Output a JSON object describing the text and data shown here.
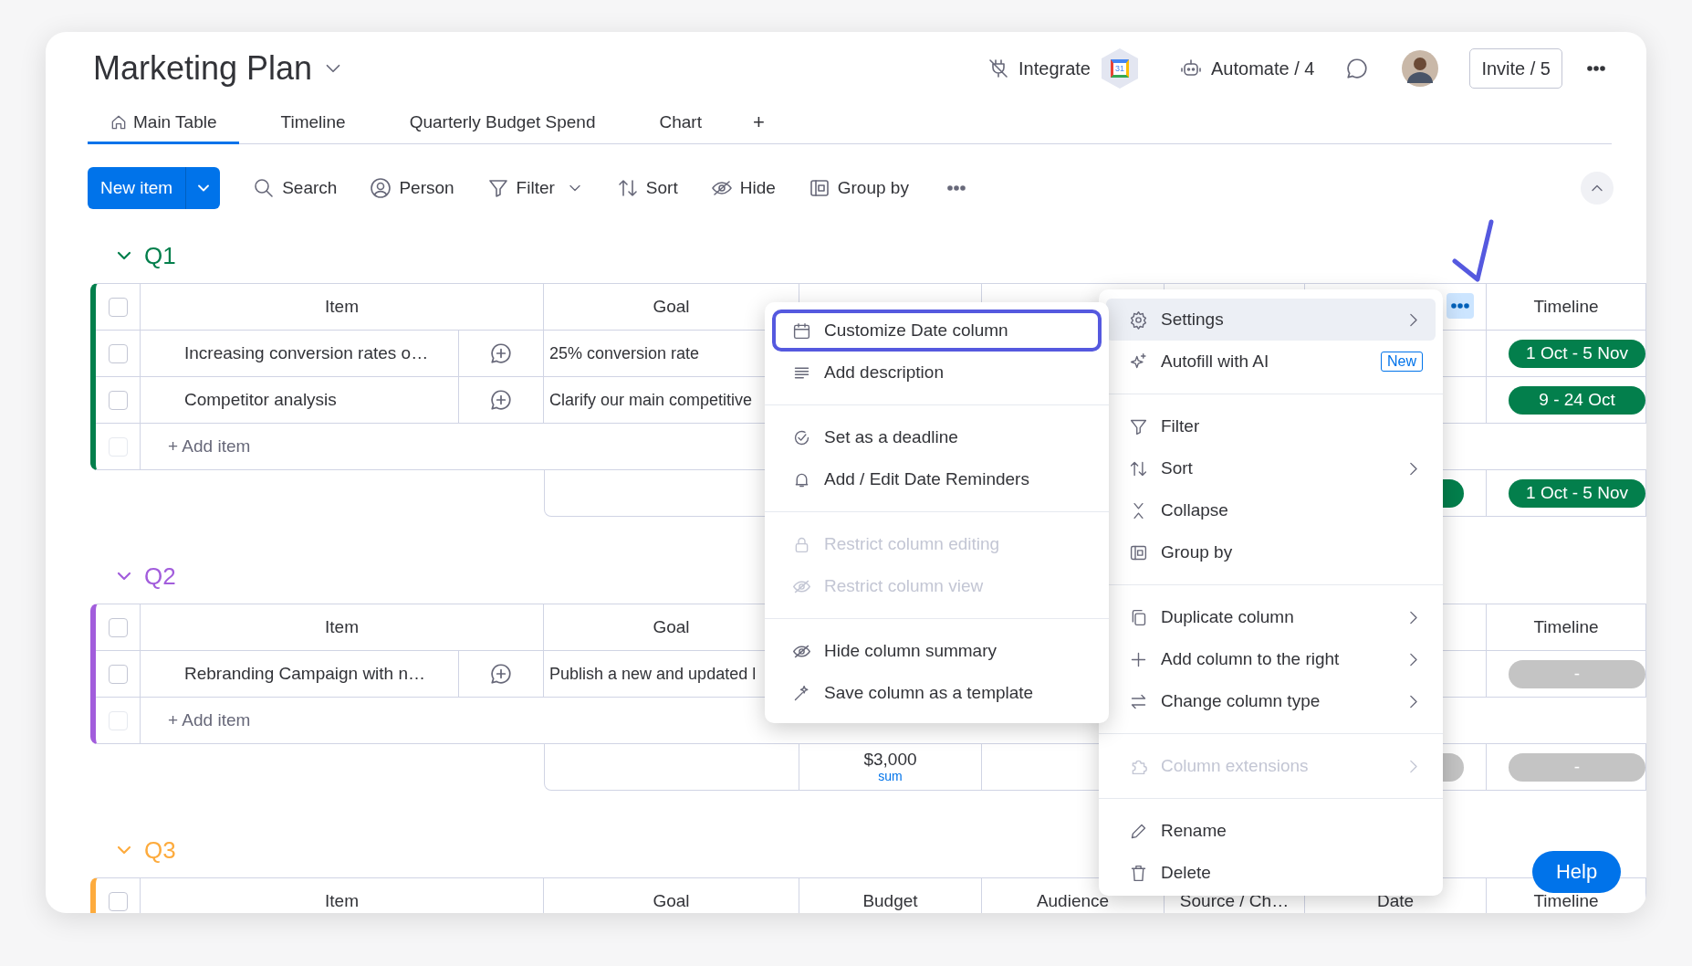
{
  "board": {
    "title": "Marketing Plan"
  },
  "header": {
    "integrate": "Integrate",
    "integration_badge": "31",
    "automate": "Automate / 4",
    "invite": "Invite / 5"
  },
  "tabs": [
    {
      "label": "Main Table",
      "selected": true,
      "kind": "home"
    },
    {
      "label": "Timeline",
      "selected": false,
      "kind": "plain"
    },
    {
      "label": "Quarterly Budget Spend",
      "selected": false,
      "kind": "plain"
    },
    {
      "label": "Chart",
      "selected": false,
      "kind": "plain"
    }
  ],
  "add_view": "+",
  "toolbar": {
    "new_item": "New item",
    "tools": [
      {
        "label": "Search",
        "kind": "search",
        "dropdown": false
      },
      {
        "label": "Person",
        "kind": "person",
        "dropdown": false
      },
      {
        "label": "Filter",
        "kind": "filter",
        "dropdown": true
      },
      {
        "label": "Sort",
        "kind": "sort",
        "dropdown": false
      },
      {
        "label": "Hide",
        "kind": "eye-off",
        "dropdown": false
      },
      {
        "label": "Group by",
        "kind": "group",
        "dropdown": false
      }
    ]
  },
  "groups": [
    {
      "name": "Q1",
      "color": "#037f4c",
      "checked": false,
      "date_menu_open": true,
      "columns": [
        {
          "kind": "item",
          "label": "Item"
        },
        {
          "kind": "goal",
          "label": "Goal"
        },
        {
          "kind": "timeline",
          "label": "Timeline"
        }
      ],
      "rows": [
        {
          "checked": false,
          "item": "Increasing conversion rates o…",
          "goal": "25% conversion rate",
          "timeline": {
            "label": "1 Oct - 5 Nov",
            "color": "#037f4c"
          }
        },
        {
          "checked": false,
          "item": "Competitor analysis",
          "goal": "Clarify our main competitive",
          "timeline": {
            "label": "9 - 24 Oct",
            "color": "#037f4c"
          }
        }
      ],
      "add_item": {
        "label": "+ Add item",
        "checked": false
      },
      "summary": {
        "date": {
          "color": "#037f4c"
        },
        "timeline": {
          "label": "1 Oct - 5 Nov",
          "color": "#037f4c"
        }
      }
    },
    {
      "name": "Q2",
      "color": "#a25ddc",
      "checked": false,
      "date_menu_open": false,
      "columns": [
        {
          "kind": "item",
          "label": "Item"
        },
        {
          "kind": "goal",
          "label": "Goal"
        },
        {
          "kind": "timeline",
          "label": "Timeline"
        }
      ],
      "rows": [
        {
          "checked": false,
          "item": "Rebranding Campaign with n…",
          "goal": "Publish a new and updated l",
          "timeline": {
            "label": "-",
            "color": "#c4c4c4"
          }
        }
      ],
      "add_item": {
        "label": "+ Add item",
        "checked": false
      },
      "summary": {
        "budget": "$3,000",
        "budget_note": "sum",
        "date": {
          "color": "#c4c4c4"
        },
        "timeline": {
          "label": "-",
          "color": "#c4c4c4"
        }
      }
    },
    {
      "name": "Q3",
      "color": "#fdab3d",
      "checked": false,
      "date_menu_open": false,
      "columns": [
        {
          "kind": "item",
          "label": "Item"
        },
        {
          "kind": "goal",
          "label": "Goal"
        },
        {
          "kind": "budget",
          "label": "Budget"
        },
        {
          "kind": "audience",
          "label": "Audience"
        },
        {
          "kind": "source",
          "label": "Source / Ch…"
        },
        {
          "kind": "date",
          "label": "Date"
        },
        {
          "kind": "timeline",
          "label": "Timeline"
        }
      ]
    }
  ],
  "settings_submenu": {
    "sections": [
      [
        {
          "label": "Customize Date column",
          "kind": "calendar",
          "selected": true,
          "disabled": false
        },
        {
          "label": "Add description",
          "kind": "lines",
          "selected": false,
          "disabled": false
        }
      ],
      [
        {
          "label": "Set as a deadline",
          "kind": "deadline",
          "selected": false,
          "disabled": false
        },
        {
          "label": "Add / Edit Date Reminders",
          "kind": "bell",
          "selected": false,
          "disabled": false
        }
      ],
      [
        {
          "label": "Restrict column editing",
          "kind": "lock",
          "selected": false,
          "disabled": true
        },
        {
          "label": "Restrict column view",
          "kind": "eye-off",
          "selected": false,
          "disabled": true
        }
      ],
      [
        {
          "label": "Hide column summary",
          "kind": "eye-off",
          "selected": false,
          "disabled": false
        },
        {
          "label": "Save column as a template",
          "kind": "wand",
          "selected": false,
          "disabled": false
        }
      ]
    ]
  },
  "column_menu": {
    "sections": [
      [
        {
          "label": "Settings",
          "kind": "gear",
          "selected": true,
          "disabled": false,
          "submenu": true
        },
        {
          "label": "Autofill with AI",
          "kind": "sparkle",
          "selected": false,
          "disabled": false,
          "submenu": false,
          "badge": "New"
        }
      ],
      [
        {
          "label": "Filter",
          "kind": "filter",
          "selected": false,
          "disabled": false,
          "submenu": false
        },
        {
          "label": "Sort",
          "kind": "sort",
          "selected": false,
          "disabled": false,
          "submenu": true
        },
        {
          "label": "Collapse",
          "kind": "collapse",
          "selected": false,
          "disabled": false,
          "submenu": false
        },
        {
          "label": "Group by",
          "kind": "group",
          "selected": false,
          "disabled": false,
          "submenu": false
        }
      ],
      [
        {
          "label": "Duplicate column",
          "kind": "copy",
          "selected": false,
          "disabled": false,
          "submenu": true
        },
        {
          "label": "Add column to the right",
          "kind": "plus",
          "selected": false,
          "disabled": false,
          "submenu": true
        },
        {
          "label": "Change column type",
          "kind": "swap",
          "selected": false,
          "disabled": false,
          "submenu": true
        }
      ],
      [
        {
          "label": "Column extensions",
          "kind": "puzzle",
          "selected": false,
          "disabled": true,
          "submenu": true
        }
      ],
      [
        {
          "label": "Rename",
          "kind": "pencil",
          "selected": false,
          "disabled": false,
          "submenu": false
        },
        {
          "label": "Delete",
          "kind": "trash",
          "selected": false,
          "disabled": false,
          "submenu": false
        }
      ]
    ]
  },
  "help": "Help"
}
